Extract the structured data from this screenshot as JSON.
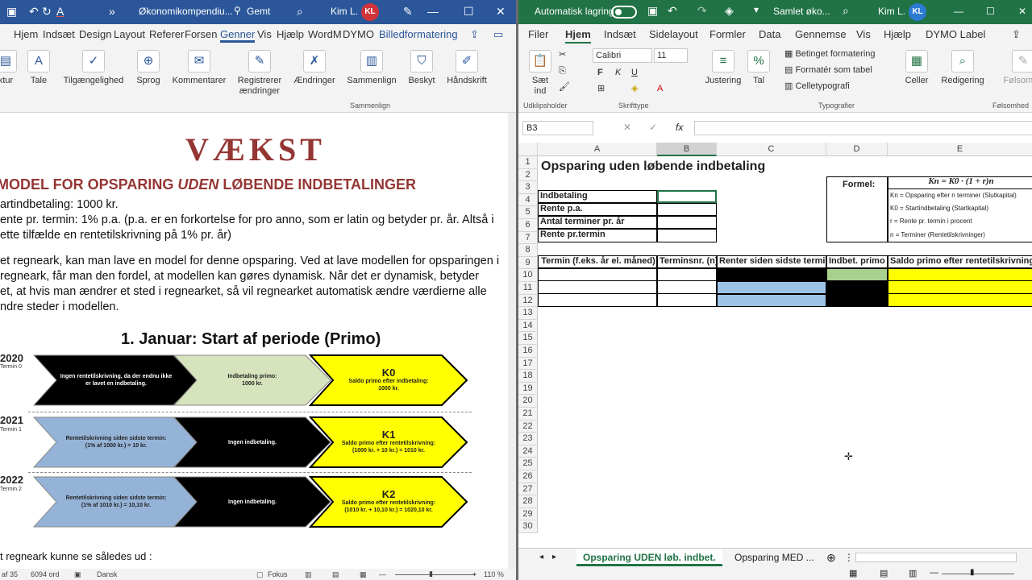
{
  "word": {
    "title": "Økonomikompendiu...",
    "saved": "Gemt",
    "user": "Kim L.",
    "initials": "KL",
    "tabs": [
      "Hjem",
      "Indsæt",
      "Design",
      "Layout",
      "Referer",
      "Forsen",
      "Genner",
      "Vis",
      "Hjælp",
      "WordM",
      "DYMO",
      "Billedformatering"
    ],
    "ribbon": {
      "tur": "ktur",
      "tale": "Tale",
      "tilg": "Tilgængelighed",
      "sprog": "Sprog",
      "komm": "Kommentarer",
      "reg1": "Registrerer",
      "reg2": "ændringer",
      "aend": "Ændringer",
      "samm": "Sammenlign",
      "samm_group": "Sammenlign",
      "besk": "Beskyt",
      "haand": "Håndskrift"
    },
    "heading": "VÆKST",
    "subheading_a": "MODEL FOR OPSPARING ",
    "subheading_b": "UDEN",
    "subheading_c": " LØBENDE INDBETALINGER",
    "lines": [
      "artindbetaling: 1000 kr.",
      "ente pr. termin: 1% p.a. (p.a. er en forkortelse for pro anno, som er latin og betyder pr. år. Altså i",
      "ette tilfælde en rentetilskrivning på 1% pr. år)",
      "et regneark, kan man lave en model for denne opsparing. Ved at lave modellen for opsparingen i",
      "regneark, får man den fordel, at modellen kan gøres dynamisk. Når det er dynamisk, betyder",
      "et, at hvis man ændrer et sted i regnearket, så vil regnearket automatisk ændre værdierne alle",
      "ndre steder i modellen."
    ],
    "section": "1. Januar: Start af periode (Primo)",
    "years": [
      "2020",
      "2021",
      "2022"
    ],
    "terms": [
      "Termin 0",
      "Termin 1",
      "Termin 2"
    ],
    "diagram": {
      "r1c1": "Ingen rentetilskrivning, da der endnu ikke er lavet en indbetaling.",
      "r1c2a": "Indbetaling primo:",
      "r1c2b": "1000 kr.",
      "r1c3k": "K0",
      "r1c3a": "Saldo primo efter indbetaling:",
      "r1c3b": "1000 kr.",
      "r2c1a": "Rentetilskrivning siden sidste termin:",
      "r2c1b": "(1% af 1000 kr.) = 10 kr.",
      "r2c2": "Ingen indbetaling.",
      "r2c3k": "K1",
      "r2c3a": "Saldo primo efter rentetilskrivning:",
      "r2c3b": "(1000 kr. + 10 kr.) = 1010 kr.",
      "r3c1a": "Rentetilskrivning siden sidste termin:",
      "r3c1b": "(1% af 1010 kr.) = 10,10 kr.",
      "r3c2": "Ingen indbetaling.",
      "r3c3k": "K2",
      "r3c3a": "Saldo primo efter rentetilskrivning:",
      "r3c3b": "(1010 kr. + 10,10 kr.) = 1020,10 kr."
    },
    "bottom_line": "t regneark kunne se således ud :",
    "status": {
      "pages": "af 35",
      "words": "6094 ord",
      "lang": "Dansk",
      "focus": "Fokus",
      "zoom": "110 %"
    }
  },
  "excel": {
    "autosave": "Automatisk lagring",
    "title": "Samlet øko...",
    "user": "Kim L.",
    "initials": "KL",
    "tabs": [
      "Filer",
      "Hjem",
      "Indsæt",
      "Sidelayout",
      "Formler",
      "Data",
      "Gennemse",
      "Vis",
      "Hjælp",
      "DYMO Label"
    ],
    "ribbon": {
      "saet": "Sæt",
      "ind": "ind",
      "font": "Calibri",
      "size": "11",
      "justering": "Justering",
      "tal": "Tal",
      "betinget": "Betinget formatering",
      "tabel": "Formatér som tabel",
      "celle": "Celletypografi",
      "celler": "Celler",
      "redigering": "Redigering",
      "foelsom": "Følsomhe",
      "grp_udk": "Udklipsholder",
      "grp_skrift": "Skrifttype",
      "grp_typo": "Typografier",
      "grp_foel": "Følsomhed"
    },
    "namebox": "B3",
    "cols": [
      "A",
      "B",
      "C",
      "D",
      "E"
    ],
    "sheet_title": "Opsparing uden løbende indbetaling",
    "labels": [
      "Indbetaling",
      "Rente p.a.",
      "Antal terminer pr. år",
      "Rente pr.termin"
    ],
    "formel_label": "Formel:",
    "formula": "Kn = K0 · (1 + r)n",
    "legend": [
      "Kn = Opsparing efter n terminer (Slutkapital)",
      "K0 = Startindbetaling (Startkapital)",
      "r = Rente pr. termin i procent",
      "n = Terminer (Rentetilskrivninger)"
    ],
    "headers": [
      "Termin (f.eks. år el. måned)",
      "Terminsnr. (n)",
      "Renter siden sidste termin",
      "Indbet. primo",
      "Saldo primo efter rentetilskrivning"
    ],
    "sheets": [
      "Opsparing UDEN løb. indbet.",
      "Opsparing MED ..."
    ],
    "colors": {
      "green": "#217346",
      "blue": "#9dc3e6",
      "yellow": "#ffff00",
      "lightgreen": "#a9d08e",
      "black": "#000000"
    }
  }
}
